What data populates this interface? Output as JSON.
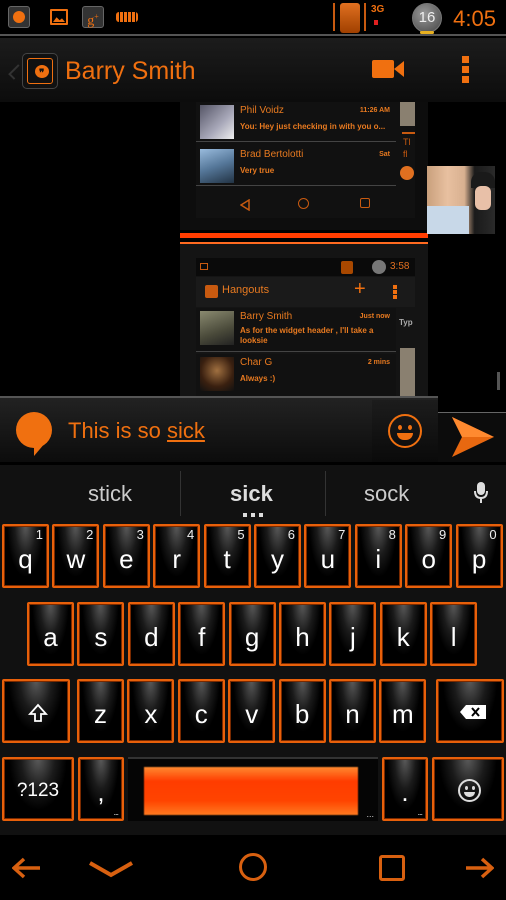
{
  "status_bar": {
    "notification_icons": [
      "hangouts-icon",
      "gallery-icon",
      "google-plus-icon",
      "keyboard-icon"
    ],
    "network": "3G",
    "badge_count": "16",
    "time": "4:05"
  },
  "action_bar": {
    "title": "Barry Smith",
    "app_icon": "hangouts-icon",
    "actions": [
      "video-call-icon",
      "overflow-menu-icon"
    ]
  },
  "shared_screenshot_top": {
    "rows": [
      {
        "name": "Phil Voidz",
        "time": "11:26 AM",
        "message": "You: Hey just checking in with you o..."
      },
      {
        "name": "Brad Bertolotti",
        "time": "Sat",
        "message": "Very true"
      }
    ],
    "side_text": "Tl fl",
    "nav_icons": [
      "back-icon",
      "home-icon",
      "recents-icon"
    ]
  },
  "shared_screenshot_bottom": {
    "status_time": "3:58",
    "app_title": "Hangouts",
    "rows": [
      {
        "name": "Barry Smith",
        "time": "Just now",
        "message": "As for the widget header , I'll take a looksie"
      },
      {
        "name": "Char G",
        "time": "2 mins",
        "message": "Always :)"
      }
    ],
    "side_text": "Typ"
  },
  "compose": {
    "text_prefix": "This is so ",
    "text_underlined": "sick",
    "emoji_button": "smiley-icon",
    "send_button": "send-icon"
  },
  "suggestions": [
    "stick",
    "sick",
    "sock"
  ],
  "keyboard": {
    "row1": [
      {
        "key": "q",
        "sup": "1"
      },
      {
        "key": "w",
        "sup": "2"
      },
      {
        "key": "e",
        "sup": "3"
      },
      {
        "key": "r",
        "sup": "4"
      },
      {
        "key": "t",
        "sup": "5"
      },
      {
        "key": "y",
        "sup": "6"
      },
      {
        "key": "u",
        "sup": "7"
      },
      {
        "key": "i",
        "sup": "8"
      },
      {
        "key": "o",
        "sup": "9"
      },
      {
        "key": "p",
        "sup": "0"
      }
    ],
    "row2": [
      "a",
      "s",
      "d",
      "f",
      "g",
      "h",
      "j",
      "k",
      "l"
    ],
    "row3": [
      "z",
      "x",
      "c",
      "v",
      "b",
      "n",
      "m"
    ],
    "symbols_label": "?123",
    "comma": ",",
    "period": ".",
    "more_dots": "...",
    "shift": "shift-icon",
    "delete": "backspace-icon",
    "emoji": "smiley-icon"
  },
  "nav_bar": [
    "left-arrow-icon",
    "hide-keyboard-icon",
    "home-icon",
    "recents-icon",
    "right-arrow-icon"
  ],
  "colors": {
    "accent": "#f07010",
    "key_border": "#e8600a",
    "space_bar": "#ff4400"
  }
}
